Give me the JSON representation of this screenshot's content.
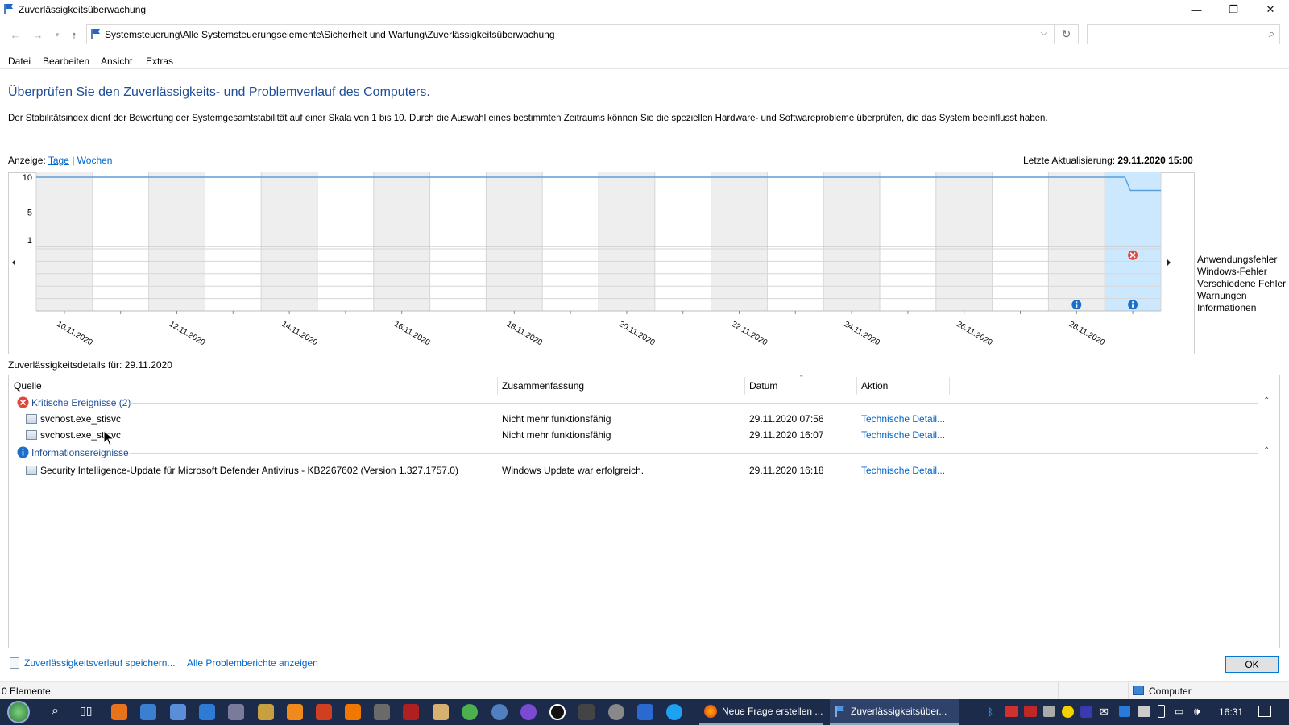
{
  "window": {
    "title": "Zuverlässigkeitsüberwachung",
    "minimize_glyph": "—",
    "restore_glyph": "❐",
    "close_glyph": "✕"
  },
  "address": {
    "path": "Systemsteuerung\\Alle Systemsteuerungselemente\\Sicherheit und Wartung\\Zuverlässigkeitsüberwachung",
    "search_placeholder": ""
  },
  "menu": {
    "items": [
      "Datei",
      "Bearbeiten",
      "Ansicht",
      "Extras"
    ]
  },
  "heading": "Überprüfen Sie den Zuverlässigkeits- und Problemverlauf des Computers.",
  "description": "Der Stabilitätsindex dient der Bewertung der Systemgesamtstabilität auf einer Skala von 1 bis 10. Durch die Auswahl eines bestimmten Zeitraums können Sie die speziellen Hardware- und Softwareprobleme überprüfen, die das System beeinflusst haben.",
  "view": {
    "label": "Anzeige:",
    "days": "Tage",
    "sep": "|",
    "weeks": "Wochen"
  },
  "last_update": {
    "label": "Letzte Aktualisierung:",
    "value": "29.11.2020 15:00"
  },
  "chart_data": {
    "type": "line",
    "title": "",
    "y_ticks": [
      "10",
      "5",
      "1"
    ],
    "ylim": [
      1,
      10
    ],
    "columns": 20,
    "x_labels": [
      "10.11.2020",
      "12.11.2020",
      "14.11.2020",
      "16.11.2020",
      "18.11.2020",
      "20.11.2020",
      "22.11.2020",
      "24.11.2020",
      "26.11.2020",
      "28.11.2020"
    ],
    "series": [
      {
        "values": [
          10,
          10,
          10,
          10,
          10,
          10,
          10,
          10,
          10,
          10,
          10,
          10,
          10,
          10,
          10,
          10,
          10,
          10,
          10,
          10,
          8.1
        ]
      }
    ],
    "selected_column": 19,
    "event_rows": [
      "Anwendungsfehler",
      "Windows-Fehler",
      "Verschiedene Fehler",
      "Warnungen",
      "Informationen"
    ],
    "events": [
      {
        "row": 0,
        "column": 19,
        "kind": "error"
      },
      {
        "row": 4,
        "column": 18,
        "kind": "info"
      },
      {
        "row": 4,
        "column": 19,
        "kind": "info"
      }
    ],
    "grid": true
  },
  "details": {
    "heading": "Zuverlässigkeitsdetails für: 29.11.2020",
    "columns": [
      "Quelle",
      "Zusammenfassung",
      "Datum",
      "Aktion"
    ],
    "critical_group": "Kritische Ereignisse (2)",
    "info_group": "Informationsereignisse",
    "critical_rows": [
      {
        "source": "svchost.exe_stisvc",
        "summary": "Nicht mehr funktionsfähig",
        "date": "29.11.2020 07:56",
        "action": "Technische Detail..."
      },
      {
        "source": "svchost.exe_stisvc",
        "summary": "Nicht mehr funktionsfähig",
        "date": "29.11.2020 16:07",
        "action": "Technische Detail..."
      }
    ],
    "info_rows": [
      {
        "source": "Security Intelligence-Update für Microsoft Defender Antivirus - KB2267602 (Version 1.327.1757.0)",
        "summary": "Windows Update war erfolgreich.",
        "date": "29.11.2020 16:18",
        "action": "Technische Detail..."
      }
    ]
  },
  "footer": {
    "save": "Zuverlässigkeitsverlauf speichern...",
    "all_reports": "Alle Problemberichte anzeigen",
    "ok": "OK"
  },
  "status": {
    "elements": "0 Elemente",
    "computer": "Computer"
  },
  "taskbar": {
    "task1": "Neue Frage erstellen ...",
    "task2": "Zuverlässigkeitsüber...",
    "clock": "16:31"
  },
  "colors": {
    "accent": "#0066cc",
    "heading": "#1e4e9a",
    "selected": "#cce8ff",
    "error": "#e0483e",
    "info": "#1a6fc9",
    "taskbar": "#1c2b4a"
  }
}
